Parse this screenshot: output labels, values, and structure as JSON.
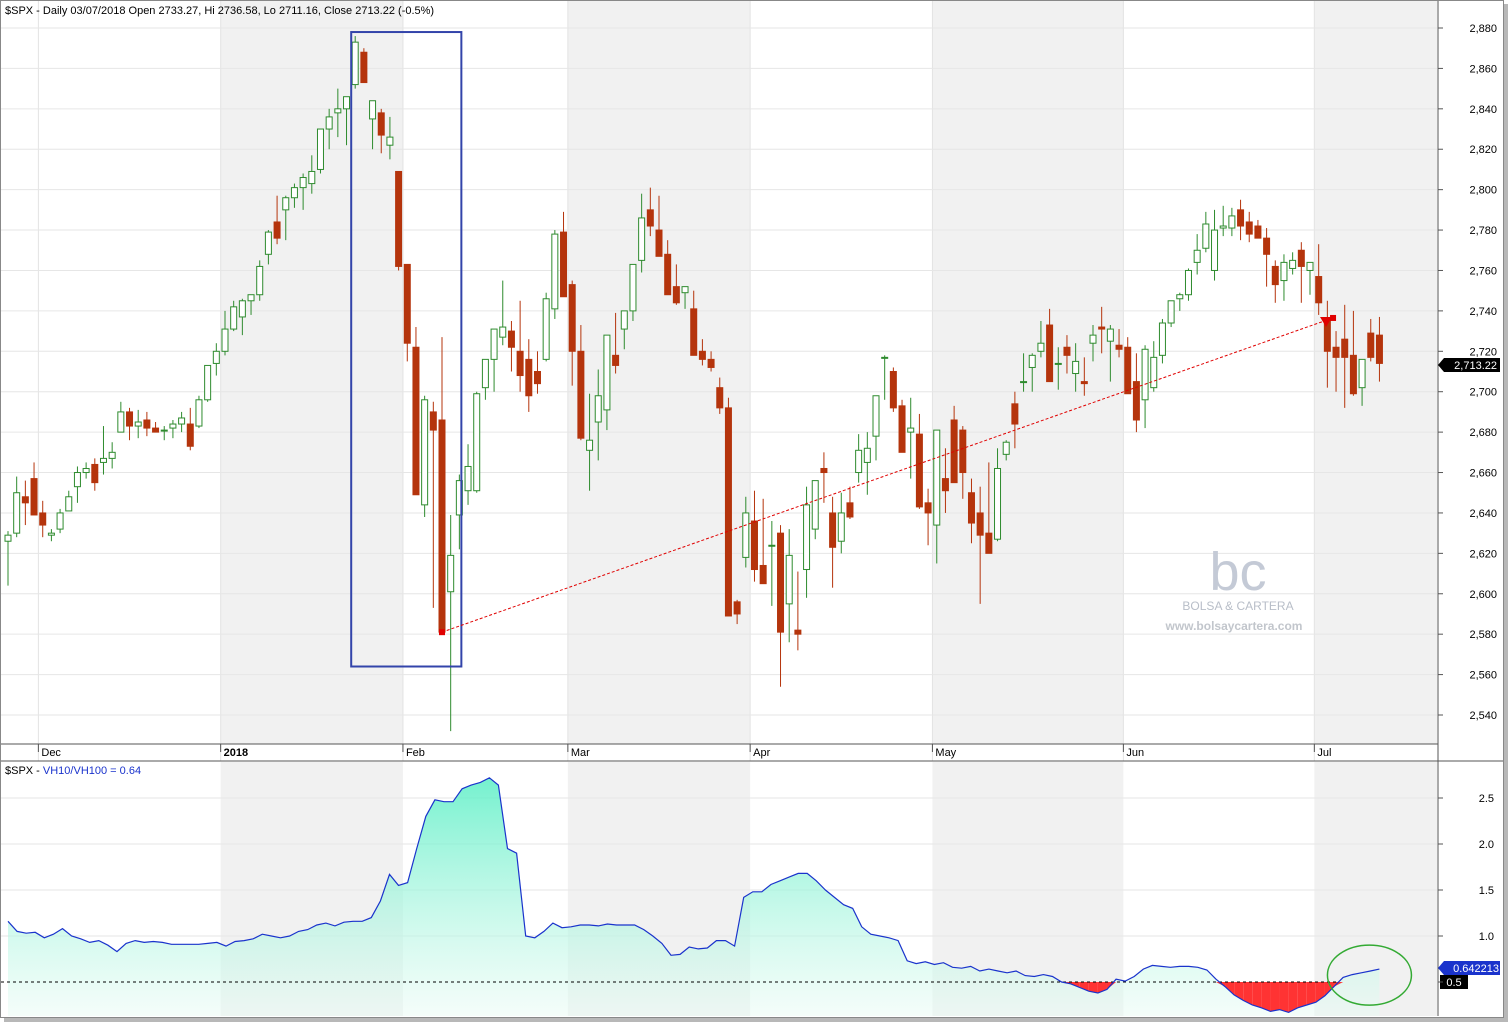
{
  "main_header": "$SPX - Daily 03/07/2018 Open 2733.27, Hi 2736.58, Lo 2711.16, Close 2713.22 (-0.5%)",
  "indicator_header": {
    "prefix": "$SPX - ",
    "label": "VH10/VH100 = 0.64"
  },
  "watermark": {
    "logo": "bc",
    "name": "BOLSA & CARTERA",
    "url": "www.bolsaycartera.com"
  },
  "colors": {
    "up_candle": "#2e8b2e",
    "down_candle": "#b5340c",
    "trendline": "#e00000",
    "highlight_box": "#3344aa",
    "indicator_line": "#1a33cc",
    "indicator_fill_top": "#66f0c8",
    "indicator_fill_neg": "#ff3333",
    "ellipse": "#33aa33",
    "last_price_tag": "#000000",
    "last_indicator_tag": "#1a33cc"
  },
  "chart_data": [
    {
      "type": "candlestick",
      "symbol": "$SPX",
      "period": "Daily",
      "ylim": [
        2530,
        2890
      ],
      "y_ticks": [
        "2,880",
        "2,860",
        "2,840",
        "2,820",
        "2,800",
        "2,780",
        "2,760",
        "2,740",
        "2,720",
        "2,700",
        "2,680",
        "2,660",
        "2,640",
        "2,620",
        "2,600",
        "2,580",
        "2,560",
        "2,540"
      ],
      "y_tick_values": [
        2880,
        2860,
        2840,
        2820,
        2800,
        2780,
        2760,
        2740,
        2720,
        2700,
        2680,
        2660,
        2640,
        2620,
        2600,
        2580,
        2560,
        2540
      ],
      "x_labels": [
        {
          "label": "Dec",
          "bold": false,
          "bar": 4
        },
        {
          "label": "2018",
          "bold": true,
          "bar": 25
        },
        {
          "label": "Feb",
          "bold": false,
          "bar": 46
        },
        {
          "label": "Mar",
          "bold": false,
          "bar": 65
        },
        {
          "label": "Apr",
          "bold": false,
          "bar": 86
        },
        {
          "label": "May",
          "bold": false,
          "bar": 107
        },
        {
          "label": "Jun",
          "bold": false,
          "bar": 129
        },
        {
          "label": "Jul",
          "bold": false,
          "bar": 151
        }
      ],
      "last_price": "2,713.22",
      "last_price_value": 2713.22,
      "ohlc": [
        [
          2626,
          2631,
          2604,
          2629
        ],
        [
          2630,
          2658,
          2628,
          2650
        ],
        [
          2648,
          2656,
          2634,
          2645
        ],
        [
          2657,
          2665,
          2640,
          2639
        ],
        [
          2640,
          2646,
          2628,
          2634
        ],
        [
          2629,
          2632,
          2626,
          2630
        ],
        [
          2632,
          2642,
          2630,
          2640
        ],
        [
          2641,
          2651,
          2641,
          2648
        ],
        [
          2653,
          2663,
          2645,
          2660
        ],
        [
          2660,
          2665,
          2657,
          2662
        ],
        [
          2664,
          2667,
          2651,
          2655
        ],
        [
          2665,
          2683,
          2659,
          2667
        ],
        [
          2667,
          2675,
          2662,
          2670
        ],
        [
          2680,
          2695,
          2680,
          2690
        ],
        [
          2690,
          2692,
          2676,
          2683
        ],
        [
          2683,
          2691,
          2677,
          2685
        ],
        [
          2686,
          2690,
          2678,
          2682
        ],
        [
          2682,
          2685,
          2680,
          2680
        ],
        [
          2681,
          2683,
          2676,
          2681
        ],
        [
          2682,
          2686,
          2677,
          2684
        ],
        [
          2684,
          2690,
          2680,
          2687
        ],
        [
          2684,
          2692,
          2671,
          2673
        ],
        [
          2683,
          2698,
          2682,
          2696
        ],
        [
          2696,
          2713,
          2695,
          2713
        ],
        [
          2714,
          2724,
          2708,
          2720
        ],
        [
          2720,
          2740,
          2718,
          2731
        ],
        [
          2731,
          2745,
          2730,
          2742
        ],
        [
          2737,
          2746,
          2728,
          2745
        ],
        [
          2745,
          2748,
          2738,
          2748
        ],
        [
          2748,
          2765,
          2745,
          2762
        ],
        [
          2768,
          2780,
          2763,
          2779
        ],
        [
          2784,
          2797,
          2773,
          2776
        ],
        [
          2790,
          2797,
          2775,
          2796
        ],
        [
          2796,
          2803,
          2791,
          2801
        ],
        [
          2801,
          2808,
          2790,
          2806
        ],
        [
          2803,
          2817,
          2798,
          2809
        ],
        [
          2810,
          2829,
          2808,
          2830
        ],
        [
          2830,
          2840,
          2820,
          2836
        ],
        [
          2838,
          2850,
          2826,
          2840
        ],
        [
          2840,
          2842,
          2822,
          2846
        ],
        [
          2852,
          2876,
          2850,
          2873
        ],
        [
          2868,
          2870,
          2855,
          2853
        ],
        [
          2835,
          2839,
          2820,
          2844
        ],
        [
          2838,
          2840,
          2818,
          2827
        ],
        [
          2822,
          2836,
          2815,
          2826
        ],
        [
          2809,
          2809,
          2760,
          2762
        ],
        [
          2763,
          2763,
          2715,
          2724
        ],
        [
          2722,
          2732,
          2650,
          2649
        ],
        [
          2644,
          2698,
          2638,
          2696
        ],
        [
          2690,
          2695,
          2593,
          2681
        ],
        [
          2686,
          2727,
          2580,
          2581
        ],
        [
          2601,
          2639,
          2532,
          2619
        ],
        [
          2639,
          2659,
          2622,
          2656
        ],
        [
          2651,
          2674,
          2644,
          2663
        ],
        [
          2651,
          2700,
          2650,
          2699
        ],
        [
          2702,
          2708,
          2696,
          2716
        ],
        [
          2716,
          2731,
          2700,
          2731
        ],
        [
          2727,
          2755,
          2723,
          2732
        ],
        [
          2730,
          2735,
          2710,
          2722
        ],
        [
          2720,
          2745,
          2700,
          2708
        ],
        [
          2716,
          2726,
          2690,
          2698
        ],
        [
          2710,
          2720,
          2699,
          2704
        ],
        [
          2716,
          2749,
          2715,
          2746
        ],
        [
          2741,
          2780,
          2736,
          2778
        ],
        [
          2779,
          2789,
          2747,
          2747
        ],
        [
          2753,
          2755,
          2703,
          2720
        ],
        [
          2720,
          2733,
          2676,
          2677
        ],
        [
          2671,
          2699,
          2651,
          2676
        ],
        [
          2685,
          2711,
          2666,
          2698
        ],
        [
          2691,
          2728,
          2681,
          2728
        ],
        [
          2718,
          2739,
          2709,
          2713
        ],
        [
          2731,
          2738,
          2721,
          2740
        ],
        [
          2740,
          2760,
          2735,
          2763
        ],
        [
          2765,
          2798,
          2759,
          2786
        ],
        [
          2790,
          2801,
          2777,
          2782
        ],
        [
          2780,
          2797,
          2775,
          2767
        ],
        [
          2768,
          2775,
          2749,
          2748
        ],
        [
          2752,
          2763,
          2743,
          2744
        ],
        [
          2749,
          2751,
          2741,
          2752
        ],
        [
          2741,
          2750,
          2720,
          2718
        ],
        [
          2720,
          2726,
          2713,
          2716
        ],
        [
          2716,
          2720,
          2710,
          2712
        ],
        [
          2702,
          2707,
          2689,
          2692
        ],
        [
          2692,
          2697,
          2589,
          2589
        ],
        [
          2596,
          2597,
          2585,
          2590
        ],
        [
          2618,
          2648,
          2613,
          2640
        ],
        [
          2636,
          2651,
          2606,
          2612
        ],
        [
          2614,
          2647,
          2606,
          2605
        ],
        [
          2624,
          2636,
          2594,
          2624
        ],
        [
          2630,
          2634,
          2554,
          2581
        ],
        [
          2595,
          2632,
          2576,
          2619
        ],
        [
          2582,
          2611,
          2572,
          2580
        ],
        [
          2612,
          2653,
          2598,
          2644
        ],
        [
          2632,
          2656,
          2627,
          2656
        ],
        [
          2662,
          2670,
          2645,
          2660
        ],
        [
          2640,
          2648,
          2603,
          2623
        ],
        [
          2626,
          2650,
          2620,
          2640
        ],
        [
          2645,
          2653,
          2637,
          2638
        ],
        [
          2660,
          2679,
          2655,
          2671
        ],
        [
          2665,
          2680,
          2649,
          2672
        ],
        [
          2678,
          2692,
          2666,
          2698
        ],
        [
          2717,
          2718,
          2696,
          2717
        ],
        [
          2710,
          2712,
          2690,
          2692
        ],
        [
          2693,
          2696,
          2678,
          2670
        ],
        [
          2680,
          2697,
          2657,
          2682
        ],
        [
          2679,
          2689,
          2642,
          2643
        ],
        [
          2645,
          2652,
          2624,
          2640
        ],
        [
          2634,
          2671,
          2615,
          2681
        ],
        [
          2657,
          2672,
          2640,
          2651
        ],
        [
          2686,
          2693,
          2660,
          2655
        ],
        [
          2681,
          2683,
          2647,
          2660
        ],
        [
          2650,
          2657,
          2625,
          2635
        ],
        [
          2640,
          2653,
          2595,
          2629
        ],
        [
          2630,
          2665,
          2625,
          2620
        ],
        [
          2627,
          2672,
          2626,
          2662
        ],
        [
          2669,
          2676,
          2666,
          2675
        ],
        [
          2694,
          2700,
          2672,
          2684
        ],
        [
          2705,
          2719,
          2700,
          2705
        ],
        [
          2712,
          2719,
          2700,
          2718
        ],
        [
          2720,
          2735,
          2717,
          2724
        ],
        [
          2733,
          2741,
          2725,
          2705
        ],
        [
          2714,
          2722,
          2701,
          2714
        ],
        [
          2722,
          2728,
          2709,
          2718
        ],
        [
          2709,
          2724,
          2700,
          2715
        ],
        [
          2705,
          2717,
          2698,
          2704
        ],
        [
          2724,
          2733,
          2715,
          2728
        ],
        [
          2732,
          2742,
          2719,
          2731
        ],
        [
          2725,
          2733,
          2705,
          2731
        ],
        [
          2723,
          2731,
          2717,
          2721
        ],
        [
          2722,
          2727,
          2708,
          2699
        ],
        [
          2705,
          2719,
          2680,
          2686
        ],
        [
          2696,
          2723,
          2682,
          2721
        ],
        [
          2702,
          2725,
          2700,
          2717
        ],
        [
          2718,
          2736,
          2714,
          2734
        ],
        [
          2734,
          2745,
          2732,
          2745
        ],
        [
          2746,
          2749,
          2740,
          2748
        ],
        [
          2748,
          2761,
          2745,
          2760
        ],
        [
          2764,
          2778,
          2758,
          2770
        ],
        [
          2771,
          2789,
          2769,
          2783
        ],
        [
          2760,
          2790,
          2755,
          2780
        ],
        [
          2781,
          2792,
          2777,
          2782
        ],
        [
          2781,
          2791,
          2777,
          2787
        ],
        [
          2790,
          2795,
          2775,
          2782
        ],
        [
          2784,
          2789,
          2774,
          2778
        ],
        [
          2782,
          2785,
          2776,
          2776
        ],
        [
          2776,
          2781,
          2752,
          2768
        ],
        [
          2762,
          2765,
          2744,
          2753
        ],
        [
          2755,
          2768,
          2745,
          2764
        ],
        [
          2761,
          2769,
          2758,
          2765
        ],
        [
          2770,
          2774,
          2744,
          2762
        ],
        [
          2760,
          2764,
          2748,
          2764
        ],
        [
          2757,
          2773,
          2738,
          2744
        ],
        [
          2736,
          2745,
          2702,
          2720
        ],
        [
          2722,
          2730,
          2700,
          2717
        ],
        [
          2726,
          2743,
          2692,
          2717
        ],
        [
          2718,
          2740,
          2698,
          2699
        ],
        [
          2702,
          2713,
          2693,
          2716
        ],
        [
          2729,
          2736,
          2715,
          2717
        ],
        [
          2728,
          2737,
          2705,
          2714
        ]
      ],
      "highlight_box": {
        "bar_start": 40,
        "bar_end": 52,
        "y_top": 2878,
        "y_bottom": 2564
      },
      "trendline": {
        "from": {
          "bar": 50,
          "value": 2581
        },
        "to": {
          "bar": 153,
          "value": 2736
        }
      }
    },
    {
      "type": "area",
      "series_name": "VH10/VH100",
      "value": "0.64",
      "last_value_label": "0.642213",
      "reference_label": "0.5",
      "reference_value": 0.5,
      "ylim": [
        0.0,
        2.8
      ],
      "y_ticks": [
        "2.5",
        "2.0",
        "1.5",
        "1.0",
        "0.5"
      ],
      "y_tick_values": [
        2.5,
        2.0,
        1.5,
        1.0,
        0.5
      ],
      "values": [
        1.16,
        1.05,
        1.03,
        1.04,
        0.98,
        1.02,
        1.08,
        1.0,
        0.97,
        0.93,
        0.95,
        0.9,
        0.83,
        0.92,
        0.95,
        0.93,
        0.94,
        0.93,
        0.91,
        0.91,
        0.91,
        0.91,
        0.92,
        0.93,
        0.89,
        0.94,
        0.95,
        0.97,
        1.02,
        1.0,
        0.98,
        1.0,
        1.05,
        1.07,
        1.12,
        1.14,
        1.11,
        1.15,
        1.16,
        1.16,
        1.2,
        1.38,
        1.67,
        1.55,
        1.58,
        1.95,
        2.3,
        2.48,
        2.46,
        2.46,
        2.6,
        2.64,
        2.67,
        2.72,
        2.64,
        1.95,
        1.9,
        1.0,
        0.98,
        1.05,
        1.14,
        1.09,
        1.1,
        1.12,
        1.12,
        1.11,
        1.13,
        1.12,
        1.12,
        1.12,
        1.07,
        1.0,
        0.92,
        0.79,
        0.8,
        0.88,
        0.86,
        0.87,
        0.95,
        0.95,
        0.89,
        1.42,
        1.48,
        1.48,
        1.56,
        1.6,
        1.64,
        1.68,
        1.68,
        1.6,
        1.5,
        1.42,
        1.34,
        1.3,
        1.1,
        1.02,
        1.0,
        0.98,
        0.95,
        0.73,
        0.7,
        0.72,
        0.69,
        0.71,
        0.66,
        0.65,
        0.67,
        0.62,
        0.64,
        0.62,
        0.6,
        0.62,
        0.57,
        0.56,
        0.58,
        0.56,
        0.5,
        0.48,
        0.44,
        0.4,
        0.38,
        0.42,
        0.53,
        0.51,
        0.56,
        0.64,
        0.68,
        0.67,
        0.66,
        0.67,
        0.67,
        0.66,
        0.63,
        0.53,
        0.45,
        0.36,
        0.3,
        0.25,
        0.22,
        0.18,
        0.2,
        0.17,
        0.22,
        0.25,
        0.28,
        0.35,
        0.45,
        0.55,
        0.58,
        0.6,
        0.62,
        0.64
      ]
    }
  ]
}
